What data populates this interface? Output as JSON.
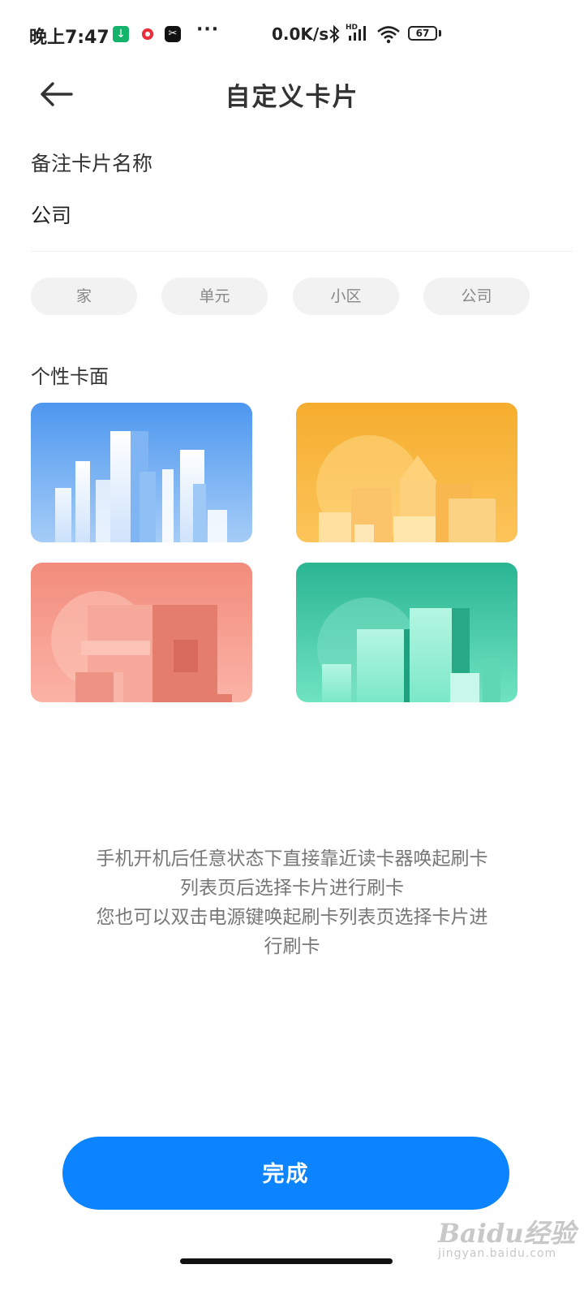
{
  "status_bar": {
    "time": "晚上7:47",
    "more": "···",
    "net_speed": "0.0K/s",
    "signal_label": "HD",
    "battery": "67",
    "icons": [
      "download-app-icon",
      "record-app-icon",
      "capcut-app-icon",
      "bluetooth-icon",
      "signal-icon",
      "wifi-icon",
      "battery-icon"
    ]
  },
  "header": {
    "back_icon": "arrow-left-icon",
    "title": "自定义卡片"
  },
  "name_field": {
    "label": "备注卡片名称",
    "value": "公司"
  },
  "quick_names": [
    "家",
    "单元",
    "小区",
    "公司"
  ],
  "card_faces": {
    "title": "个性卡面",
    "items": [
      {
        "theme": "blue-city",
        "color": "#5aa0f0"
      },
      {
        "theme": "yellow-houses",
        "color": "#f6b93b"
      },
      {
        "theme": "coral-buildings",
        "color": "#f6998a"
      },
      {
        "theme": "green-towers",
        "color": "#35c49c"
      }
    ]
  },
  "hint": {
    "line1": "手机开机后任意状态下直接靠近读卡器唤起刷卡",
    "line2": "列表页后选择卡片进行刷卡",
    "line3": "您也可以双击电源键唤起刷卡列表页选择卡片进",
    "line4": "行刷卡"
  },
  "done_button": "完成",
  "watermark": {
    "main": "Baidu经验",
    "sub": "jingyan.baidu.com"
  },
  "colors": {
    "accent": "#0d84ff",
    "chip_bg": "#f2f2f2",
    "hint_text": "#777777"
  }
}
